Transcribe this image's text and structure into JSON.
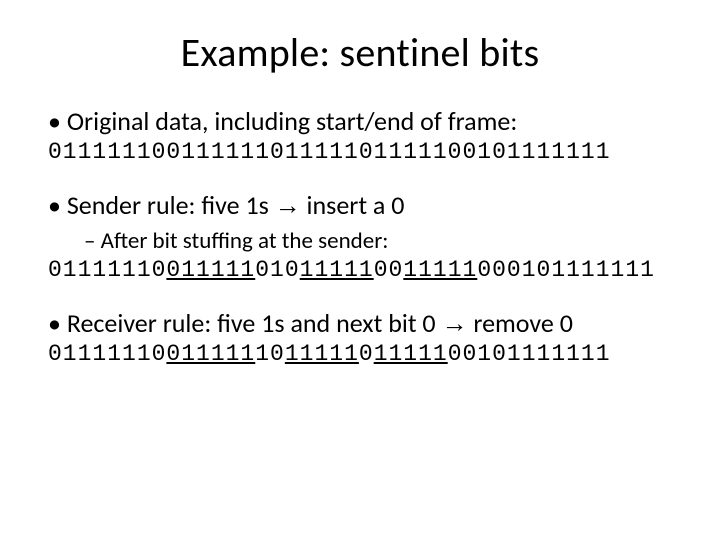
{
  "title": "Example: sentinel bits",
  "b1": "Original data, including start/end of frame:",
  "bits1_a": "01111110",
  "bits1_b": "01111110111110111110",
  "bits1_c": "0101111111",
  "b2_pre": "Sender rule: five 1s ",
  "arrow": "→",
  "b2_post": " insert a 0",
  "sub2": "After bit stuffing at the sender:",
  "s2_a": "01111110",
  "s2_u1": "011111",
  "s2_b": "010",
  "s2_u2": "11111",
  "s2_c": "00",
  "s2_u3": "11111",
  "s2_d": "000101111111",
  "b3_pre": "Receiver rule: five 1s and next bit 0 ",
  "b3_post": " remove 0",
  "r_a": "01111110",
  "r_u1": "011111",
  "r_b": "10",
  "r_u2": "11111",
  "r_c": "0",
  "r_u3": "11111",
  "r_d": "00101111111"
}
